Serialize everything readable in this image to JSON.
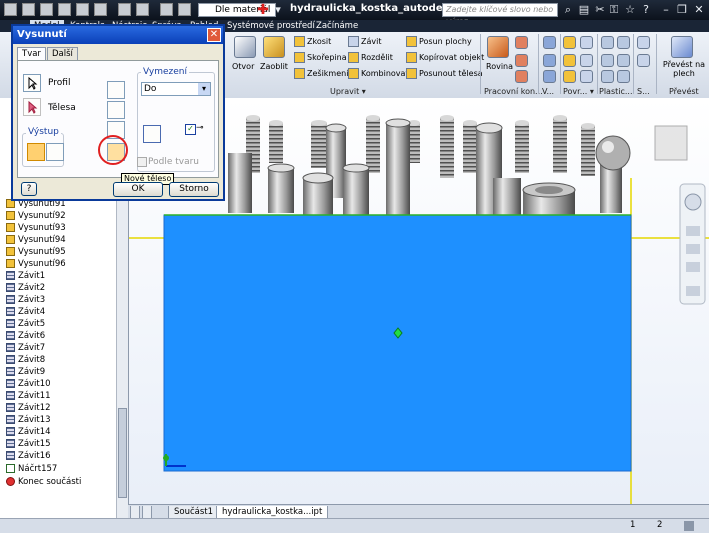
{
  "app": {
    "material": "Dle materiál",
    "window_title": "hydraulicka_kostka_autodes...",
    "search_placeholder": "Zadejte klíčové slovo nebo výraz."
  },
  "ribbon_tabs": [
    "Model",
    "Kontrola",
    "Nástroje",
    "Správa",
    "Pohled",
    "Systémové prostředí",
    "Začínáme"
  ],
  "ribbon": {
    "otvor": "Otvor",
    "zaoblit": "Zaoblit",
    "zkosit": "Zkosit",
    "skorepina": "Skořepina",
    "zesilkmeni": "Zešikmení",
    "zavit": "Závit",
    "rozdelit": "Rozdělit",
    "kombinovat": "Kombinovat",
    "posun_plochy": "Posun plochy",
    "kopirovat_objekt": "Kopírovat objekt",
    "posunout_telesa": "Posunout tělesa",
    "rovina": "Rovina",
    "prevest_line1": "Převést na",
    "prevest_line2": "plech",
    "groups": {
      "upravit": "Upravit ▾",
      "pracovni": "Pracovní kon...",
      "v": "V...",
      "povrch": "Povr... ▾",
      "plastic": "Plastic...",
      "s": "S...",
      "prevest": "Převést"
    }
  },
  "dialog": {
    "title": "Vysunutí",
    "tab_tvar": "Tvar",
    "tab_dalsi": "Další",
    "profil": "Profil",
    "telesa": "Tělesa",
    "vystup": "Výstup",
    "vymezeni": "Vymezení",
    "vymezeni_value": "Do",
    "podle_tvaru": "Podle tvaru",
    "tooltip": "Nové těleso",
    "ok": "OK",
    "storno": "Storno",
    "help": "?"
  },
  "browser": {
    "items": [
      {
        "label": "Vysunutí91",
        "icon": "extrude-icon"
      },
      {
        "label": "Vysunutí92",
        "icon": "extrude-icon"
      },
      {
        "label": "Vysunutí93",
        "icon": "extrude-icon"
      },
      {
        "label": "Vysunutí94",
        "icon": "extrude-icon"
      },
      {
        "label": "Vysunutí95",
        "icon": "extrude-icon"
      },
      {
        "label": "Vysunutí96",
        "icon": "extrude-icon"
      },
      {
        "label": "Závit1",
        "icon": "thread-icon"
      },
      {
        "label": "Závit2",
        "icon": "thread-icon"
      },
      {
        "label": "Závit3",
        "icon": "thread-icon"
      },
      {
        "label": "Závit4",
        "icon": "thread-icon"
      },
      {
        "label": "Závit5",
        "icon": "thread-icon"
      },
      {
        "label": "Závit6",
        "icon": "thread-icon"
      },
      {
        "label": "Závit7",
        "icon": "thread-icon"
      },
      {
        "label": "Závit8",
        "icon": "thread-icon"
      },
      {
        "label": "Závit9",
        "icon": "thread-icon"
      },
      {
        "label": "Závit10",
        "icon": "thread-icon"
      },
      {
        "label": "Závit11",
        "icon": "thread-icon"
      },
      {
        "label": "Závit12",
        "icon": "thread-icon"
      },
      {
        "label": "Závit13",
        "icon": "thread-icon"
      },
      {
        "label": "Závit14",
        "icon": "thread-icon"
      },
      {
        "label": "Závit15",
        "icon": "thread-icon"
      },
      {
        "label": "Závit16",
        "icon": "thread-icon"
      },
      {
        "label": "Náčrt157",
        "icon": "sketch-icon"
      },
      {
        "label": "Konec součásti",
        "icon": "end-of-part-icon"
      }
    ]
  },
  "doc_tabs": [
    "Součást1",
    "hydraulicka_kostka...ipt"
  ],
  "status": {
    "page1": "1",
    "page2": "2"
  },
  "colors": {
    "sketch_fill": "#1e90ff",
    "highlight_ring": "#e02020",
    "titlebar": "#0c121c"
  }
}
